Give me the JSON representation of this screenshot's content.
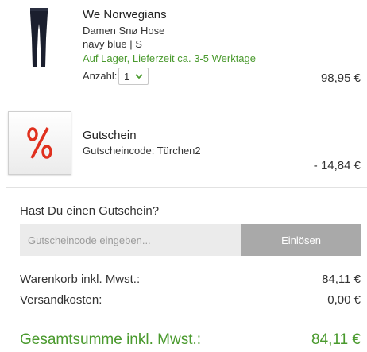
{
  "cart_item": {
    "brand": "We Norwegians",
    "name": "Damen Snø Hose",
    "variant": "navy blue | S",
    "stock": "Auf Lager, Lieferzeit ca. 3-5 Werktage",
    "qty_label": "Anzahl:",
    "qty_value": "1",
    "price": "98,95 €",
    "image_icon": "leggings-image"
  },
  "coupon_item": {
    "icon": "%",
    "title": "Gutschein",
    "code": "Gutscheincode: Türchen2",
    "amount": "- 14,84 €"
  },
  "coupon_form": {
    "heading": "Hast Du einen Gutschein?",
    "placeholder": "Gutscheincode eingeben...",
    "button_label": "Einlösen"
  },
  "summary": {
    "subtotal_label": "Warenkorb inkl. Mwst.:",
    "subtotal_value": "84,11 €",
    "shipping_label": "Versandkosten:",
    "shipping_value": "0,00 €",
    "total_label": "Gesamtsumme inkl. Mwst.:",
    "total_value": "84,11 €"
  },
  "colors": {
    "accent_green": "#4a9a2e",
    "coupon_red": "#e0301e",
    "button_gray": "#a9a9a9"
  }
}
